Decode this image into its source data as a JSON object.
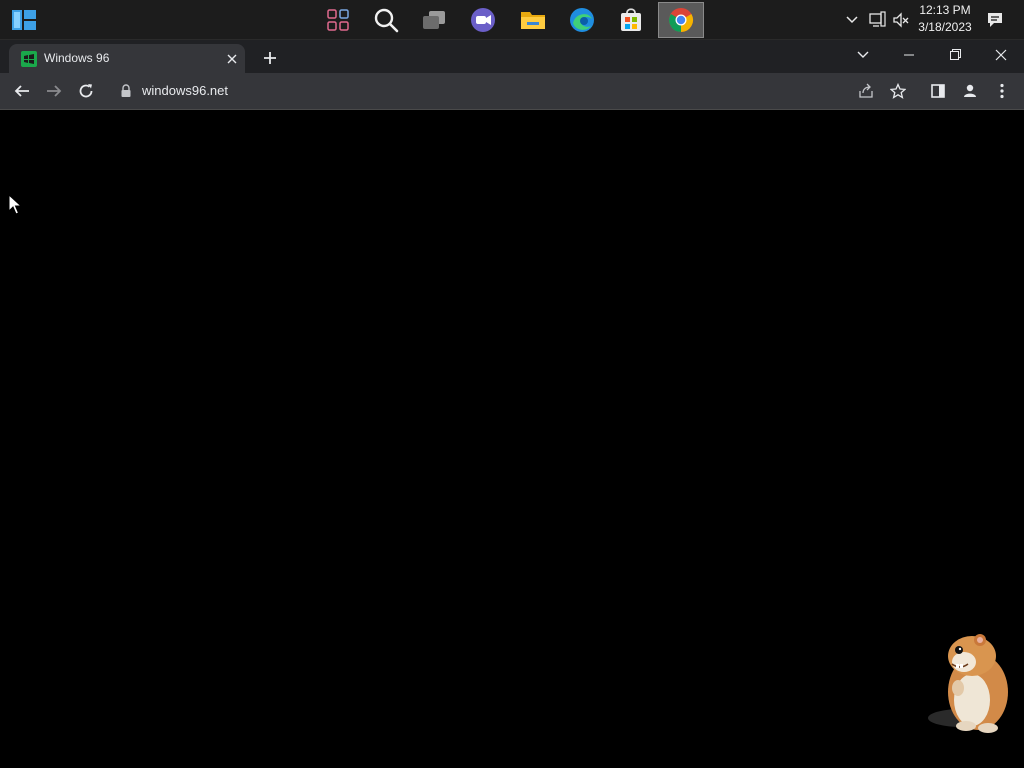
{
  "taskbar": {
    "items": [
      {
        "name": "Start",
        "icon": "windows-logo-icon"
      },
      {
        "name": "Widgets",
        "icon": "widgets-icon"
      },
      {
        "name": "Search",
        "icon": "search-icon"
      },
      {
        "name": "Task View",
        "icon": "task-view-icon"
      },
      {
        "name": "Teams Chat",
        "icon": "teams-chat-icon"
      },
      {
        "name": "File Explorer",
        "icon": "folder-icon"
      },
      {
        "name": "Microsoft Edge",
        "icon": "edge-icon"
      },
      {
        "name": "Microsoft Store",
        "icon": "store-icon"
      },
      {
        "name": "Google Chrome",
        "icon": "chrome-icon",
        "active": true
      }
    ],
    "clock": {
      "time": "12:13 PM",
      "date": "3/18/2023"
    }
  },
  "browser": {
    "tab": {
      "title": "Windows 96",
      "favicon": "windows96-favicon"
    },
    "address": {
      "url": "windows96.net"
    }
  },
  "colors": {
    "taskbar_bg": "#1c1c1c",
    "tabstrip_bg": "#202124",
    "toolbar_bg": "#35363a",
    "page_bg": "#000000"
  }
}
